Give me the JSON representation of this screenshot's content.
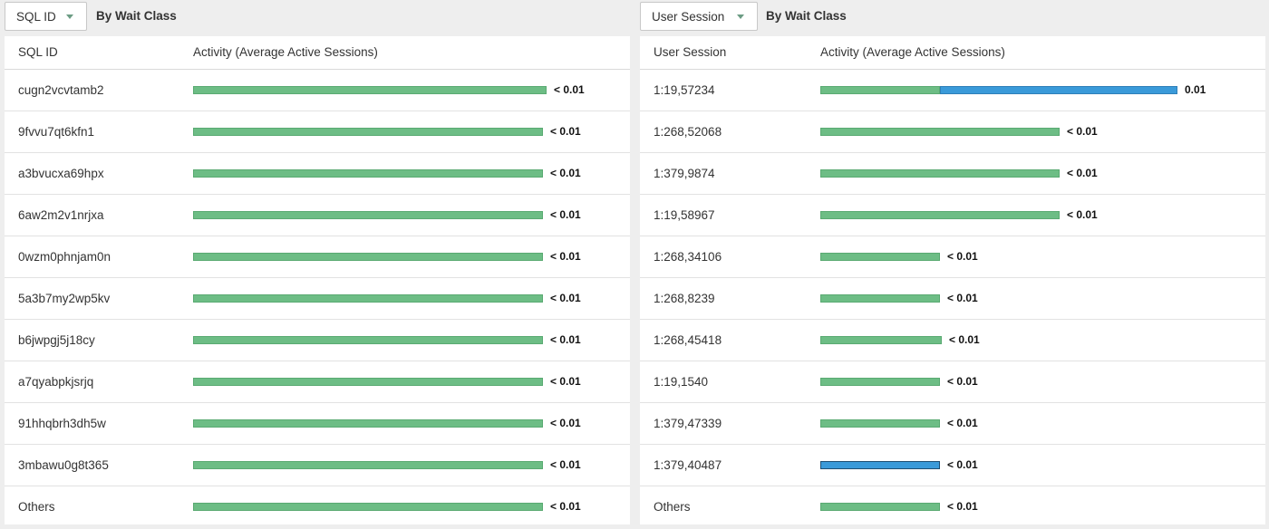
{
  "colors": {
    "cpu_green": "#6dbd85",
    "user_io_blue": "#3a9ad9",
    "panel_bg": "#ffffff",
    "page_bg": "#eeeeee"
  },
  "left_panel": {
    "dropdown_label": "SQL ID",
    "dropdown_icon": "chevron-down-icon",
    "group_label": "By Wait Class",
    "headers": {
      "key": "SQL ID",
      "activity": "Activity (Average Active Sessions)"
    },
    "rows": [
      {
        "key": "cugn2vcvtamb2",
        "value": "< 0.01",
        "segments": [
          {
            "color": "green",
            "fraction": 1.0
          }
        ]
      },
      {
        "key": "9fvvu7qt6kfn1",
        "value": "< 0.01",
        "segments": [
          {
            "color": "green",
            "fraction": 0.99
          }
        ]
      },
      {
        "key": "a3bvucxa69hpx",
        "value": "< 0.01",
        "segments": [
          {
            "color": "green",
            "fraction": 0.99
          }
        ]
      },
      {
        "key": "6aw2m2v1nrjxa",
        "value": "< 0.01",
        "segments": [
          {
            "color": "green",
            "fraction": 0.99
          }
        ]
      },
      {
        "key": "0wzm0phnjam0n",
        "value": "< 0.01",
        "segments": [
          {
            "color": "green",
            "fraction": 0.99
          }
        ]
      },
      {
        "key": "5a3b7my2wp5kv",
        "value": "< 0.01",
        "segments": [
          {
            "color": "green",
            "fraction": 0.99
          }
        ]
      },
      {
        "key": "b6jwpgj5j18cy",
        "value": "< 0.01",
        "segments": [
          {
            "color": "green",
            "fraction": 0.99
          }
        ]
      },
      {
        "key": "a7qyabpkjsrjq",
        "value": "< 0.01",
        "segments": [
          {
            "color": "green",
            "fraction": 0.99
          }
        ]
      },
      {
        "key": "91hhqbrh3dh5w",
        "value": "< 0.01",
        "segments": [
          {
            "color": "green",
            "fraction": 0.99
          }
        ]
      },
      {
        "key": "3mbawu0g8t365",
        "value": "< 0.01",
        "segments": [
          {
            "color": "green",
            "fraction": 0.99
          }
        ]
      },
      {
        "key": "Others",
        "value": "< 0.01",
        "segments": [
          {
            "color": "green",
            "fraction": 0.99
          }
        ]
      }
    ]
  },
  "right_panel": {
    "dropdown_label": "User Session",
    "dropdown_icon": "chevron-down-icon",
    "group_label": "By Wait Class",
    "headers": {
      "key": "User Session",
      "activity": "Activity (Average Active Sessions)"
    },
    "rows": [
      {
        "key": "1:19,57234",
        "value": "0.01",
        "segments": [
          {
            "color": "green",
            "fraction": 0.335
          },
          {
            "color": "blue",
            "fraction": 0.665
          }
        ]
      },
      {
        "key": "1:268,52068",
        "value": "< 0.01",
        "segments": [
          {
            "color": "green",
            "fraction": 0.67
          }
        ]
      },
      {
        "key": "1:379,9874",
        "value": "< 0.01",
        "segments": [
          {
            "color": "green",
            "fraction": 0.67
          }
        ]
      },
      {
        "key": "1:19,58967",
        "value": "< 0.01",
        "segments": [
          {
            "color": "green",
            "fraction": 0.67
          }
        ]
      },
      {
        "key": "1:268,34106",
        "value": "< 0.01",
        "segments": [
          {
            "color": "green",
            "fraction": 0.335
          }
        ]
      },
      {
        "key": "1:268,8239",
        "value": "< 0.01",
        "segments": [
          {
            "color": "green",
            "fraction": 0.335
          }
        ]
      },
      {
        "key": "1:268,45418",
        "value": "< 0.01",
        "segments": [
          {
            "color": "green",
            "fraction": 0.34
          }
        ]
      },
      {
        "key": "1:19,1540",
        "value": "< 0.01",
        "segments": [
          {
            "color": "green",
            "fraction": 0.335
          }
        ]
      },
      {
        "key": "1:379,47339",
        "value": "< 0.01",
        "segments": [
          {
            "color": "green",
            "fraction": 0.335
          }
        ]
      },
      {
        "key": "1:379,40487",
        "value": "< 0.01",
        "segments": [
          {
            "color": "blue",
            "fraction": 0.335
          }
        ]
      },
      {
        "key": "Others",
        "value": "< 0.01",
        "segments": [
          {
            "color": "green",
            "fraction": 0.335
          }
        ]
      }
    ]
  }
}
